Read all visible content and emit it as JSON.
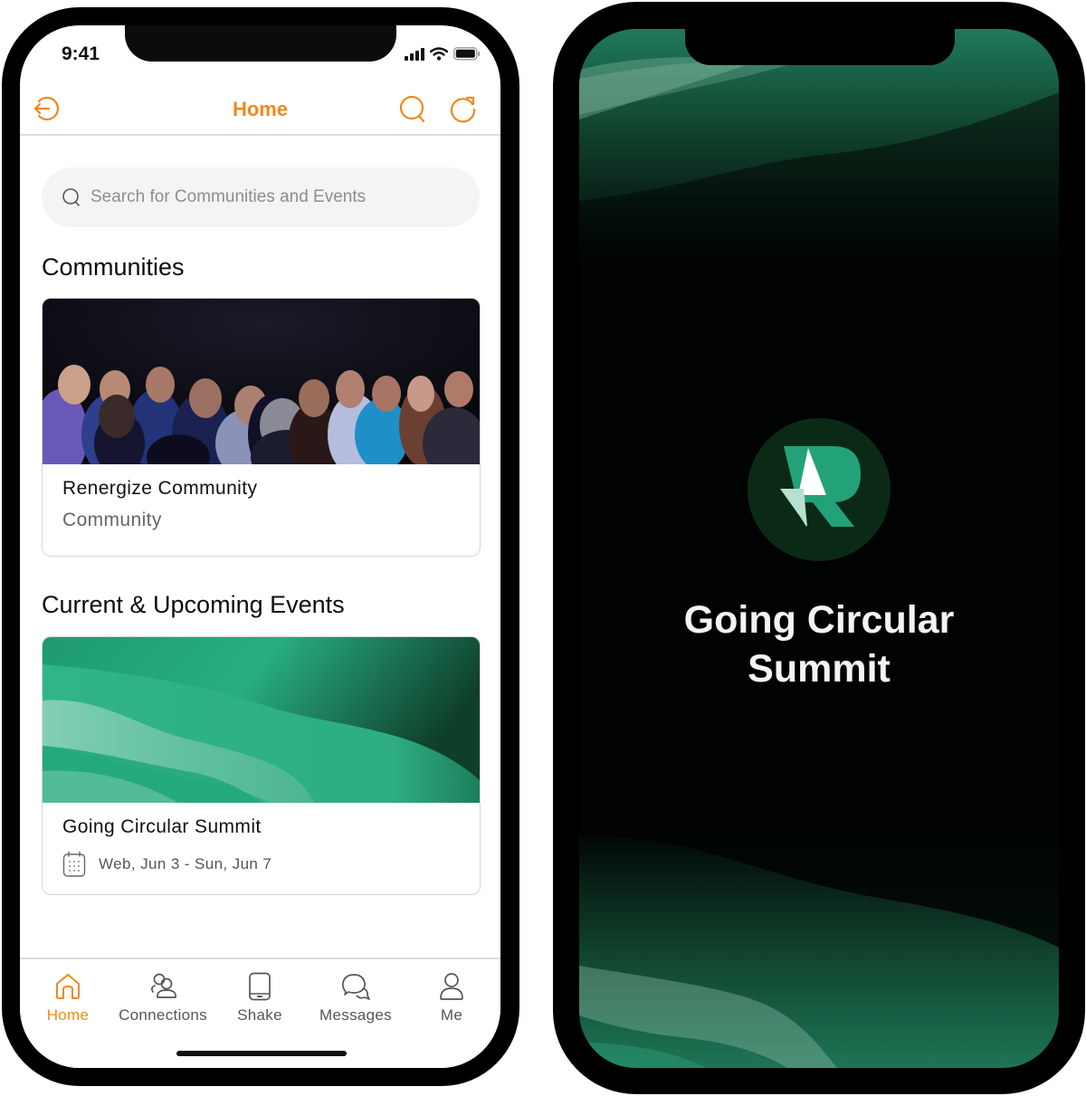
{
  "left_phone": {
    "status_bar": {
      "time": "9:41",
      "icons": [
        "signal-icon",
        "wifi-icon",
        "battery-icon"
      ]
    },
    "header": {
      "title": "Home",
      "left_icon": "logout-icon",
      "right_icons": [
        "search-icon",
        "refresh-icon"
      ]
    },
    "search": {
      "placeholder": "Search for Communities and Events",
      "value": ""
    },
    "communities": {
      "title": "Communities",
      "cards": [
        {
          "title": "Renergize Community",
          "subtitle": "Community",
          "image": "audience-photo"
        }
      ]
    },
    "events": {
      "title": "Current & Upcoming Events",
      "cards": [
        {
          "title": "Going Circular Summit",
          "date": "Web, Jun 3 - Sun, Jun 7",
          "date_icon": "calendar-icon",
          "image": "green-wave-banner"
        }
      ]
    },
    "tabbar": {
      "active": "Home",
      "items": [
        {
          "label": "Home",
          "icon": "home-icon"
        },
        {
          "label": "Connections",
          "icon": "people-icon"
        },
        {
          "label": "Shake",
          "icon": "phone-icon"
        },
        {
          "label": "Messages",
          "icon": "chat-icon"
        },
        {
          "label": "Me",
          "icon": "person-icon"
        }
      ]
    }
  },
  "right_phone": {
    "splash": {
      "logo": "renergize-r-logo",
      "title_line1": "Going Circular",
      "title_line2": "Summit"
    }
  },
  "colors": {
    "accent": "#f0891a",
    "brand_green": "#23a27a",
    "brand_dark": "#0b2a16"
  }
}
